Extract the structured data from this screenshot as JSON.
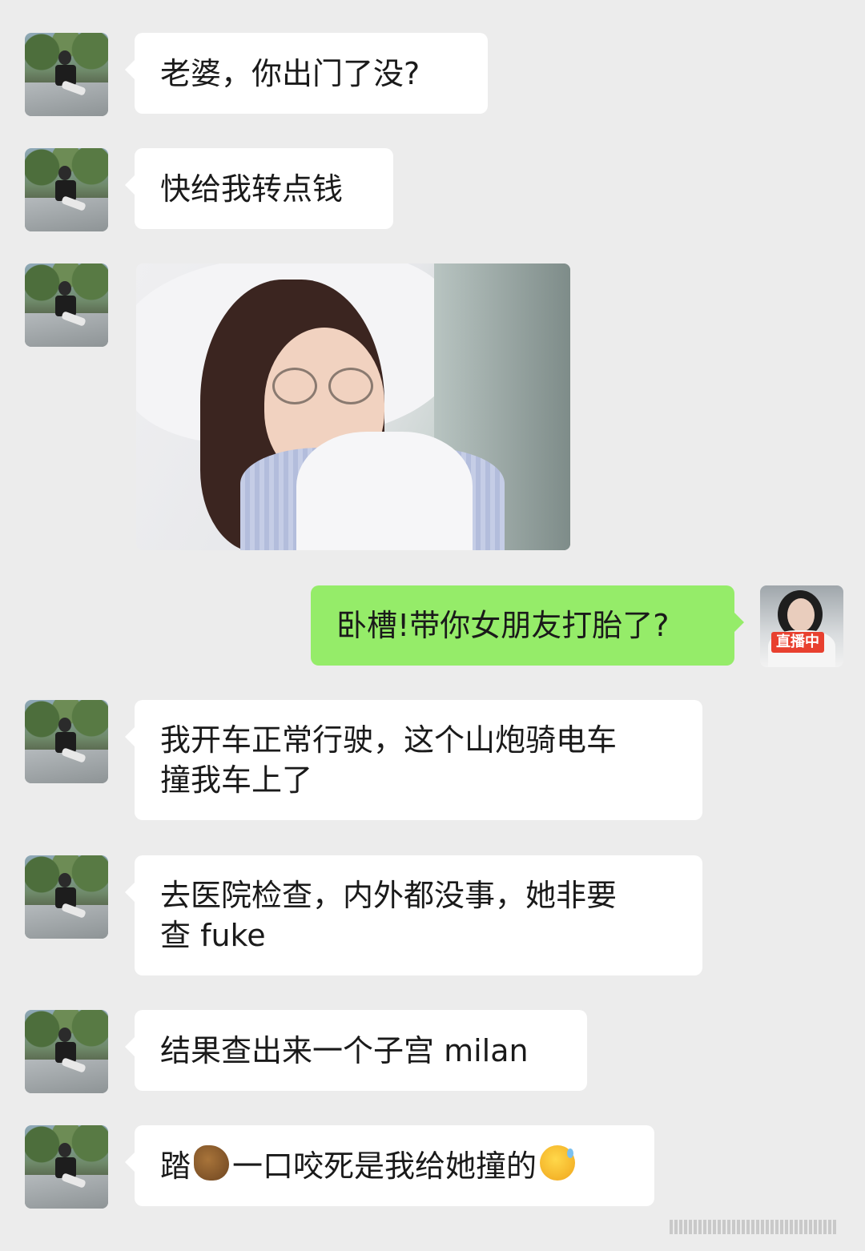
{
  "messages": [
    {
      "side": "left",
      "text": "老婆，你出门了没?"
    },
    {
      "side": "left",
      "text": "快给我转点钱"
    },
    {
      "side": "left",
      "type": "image"
    },
    {
      "side": "right",
      "text": "卧槽!带你女朋友打胎了?"
    },
    {
      "side": "left",
      "text": "我开车正常行驶，这个山炮骑电车\n撞我车上了"
    },
    {
      "side": "left",
      "text": "去医院检查，内外都没事，她非要\n查 fuke"
    },
    {
      "side": "left",
      "text": "结果查出来一个子宫 milan"
    },
    {
      "side": "left",
      "text_before": "踏",
      "icon": "horse-icon",
      "text_after": "一口咬死是我给她撞的",
      "emoji": "sweat-icon"
    }
  ],
  "my_avatar": {
    "badge": "直播中"
  }
}
